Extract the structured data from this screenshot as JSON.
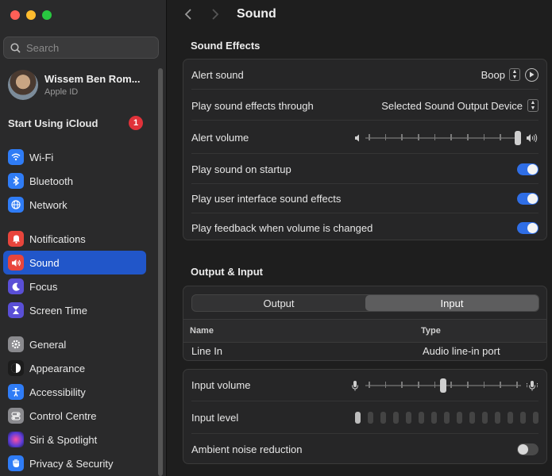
{
  "window": {
    "controls": [
      "close",
      "minimize",
      "zoom"
    ]
  },
  "sidebar": {
    "search_placeholder": "Search",
    "profile": {
      "name": "Wissem Ben Rom...",
      "subtitle": "Apple ID"
    },
    "icloud": {
      "label": "Start Using iCloud",
      "badge": "1"
    },
    "items": [
      {
        "label": "Wi-Fi",
        "icon": "wifi-icon",
        "color": "#2f7cf6"
      },
      {
        "label": "Bluetooth",
        "icon": "bluetooth-icon",
        "color": "#2f7cf6"
      },
      {
        "label": "Network",
        "icon": "globe-icon",
        "color": "#2f7cf6"
      },
      {
        "label": "Notifications",
        "icon": "bell-icon",
        "color": "#e8453c"
      },
      {
        "label": "Sound",
        "icon": "speaker-icon",
        "color": "#e8453c"
      },
      {
        "label": "Focus",
        "icon": "moon-icon",
        "color": "#5a4fd6"
      },
      {
        "label": "Screen Time",
        "icon": "hourglass-icon",
        "color": "#5a4fd6"
      },
      {
        "label": "General",
        "icon": "gear-icon",
        "color": "#8a8a8e"
      },
      {
        "label": "Appearance",
        "icon": "appearance-icon",
        "color": "#1c1c1c"
      },
      {
        "label": "Accessibility",
        "icon": "accessibility-icon",
        "color": "#2f7cf6"
      },
      {
        "label": "Control Centre",
        "icon": "control-centre-icon",
        "color": "#8a8a8e"
      },
      {
        "label": "Siri & Spotlight",
        "icon": "siri-icon",
        "color": "#8a3cd6"
      },
      {
        "label": "Privacy & Security",
        "icon": "hand-icon",
        "color": "#2f7cf6"
      }
    ],
    "selected": "Sound"
  },
  "header": {
    "title": "Sound"
  },
  "sound_effects": {
    "heading": "Sound Effects",
    "alert_sound": {
      "label": "Alert sound",
      "value": "Boop"
    },
    "output_device": {
      "label": "Play sound effects through",
      "value": "Selected Sound Output Device"
    },
    "alert_volume": {
      "label": "Alert volume",
      "level": 1.0
    },
    "startup": {
      "label": "Play sound on startup",
      "on": true
    },
    "ui_effects": {
      "label": "Play user interface sound effects",
      "on": true
    },
    "feedback": {
      "label": "Play feedback when volume is changed",
      "on": true
    }
  },
  "output_input": {
    "heading": "Output & Input",
    "tabs": [
      "Output",
      "Input"
    ],
    "selected_tab": "Input",
    "columns": [
      "Name",
      "Type"
    ],
    "rows": [
      {
        "name": "Line In",
        "type": "Audio line-in port"
      }
    ],
    "input_volume": {
      "label": "Input volume",
      "level": 0.5
    },
    "input_level": {
      "label": "Input level",
      "active_bars": 1,
      "total_bars": 15
    },
    "ambient": {
      "label": "Ambient noise reduction",
      "on": false
    }
  },
  "colors": {
    "accent": "#2f6ee6",
    "selection": "#2156c9"
  }
}
